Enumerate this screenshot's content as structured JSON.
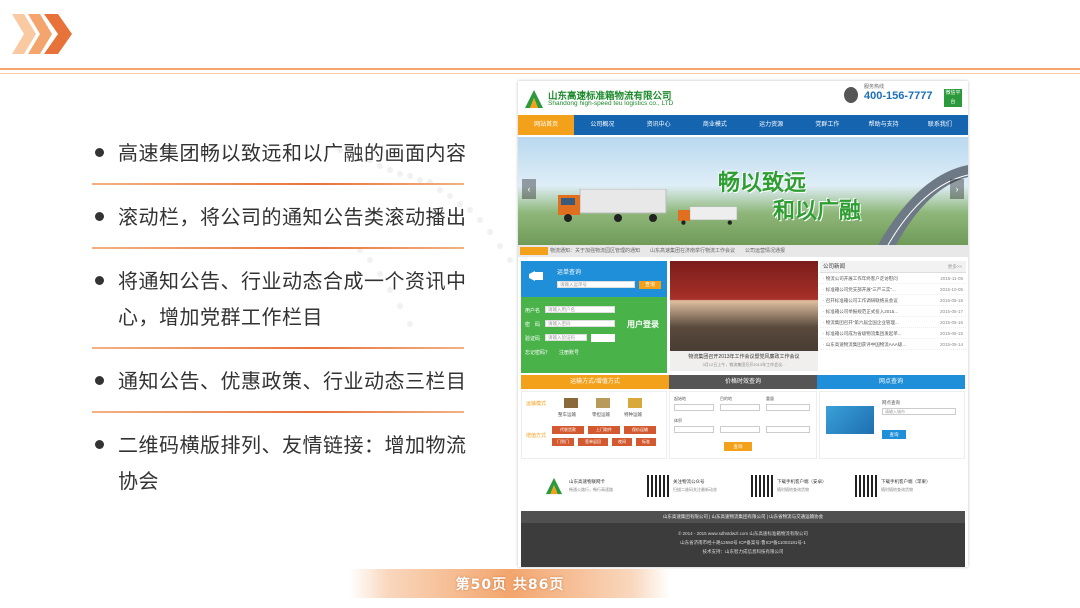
{
  "slide": {
    "bullets": [
      "高速集团畅以致远和以广融的画面内容",
      "滚动栏，将公司的通知公告类滚动播出",
      "将通知公告、行业动态合成一个资讯中心，增加党群工作栏目",
      "通知公告、优惠政策、行业动态三栏目",
      "二维码横版排列、友情链接：增加物流协会"
    ],
    "page_indicator": "第50页 共86页"
  },
  "site": {
    "company_cn": "山东高速标准箱物流有限公司",
    "company_en": "Shandong high-speed teu logistics co., LTD",
    "hotline_label": "服务热线",
    "phone": "400-156-7777",
    "wechat": "微信平台",
    "nav": [
      "网站首页",
      "公司概况",
      "资讯中心",
      "商业模式",
      "运力资源",
      "党群工作",
      "帮助与支持",
      "联系我们"
    ],
    "banner_line1": "畅以致远",
    "banner_line2": "和以广融",
    "ticker": "物流通知：关于加强物流园区管理的通知　　山东高速集团在济南举行物流工作会议　　公司运营情况通报",
    "login": {
      "search_title": "运单查询",
      "search_placeholder": "请输入运单号",
      "search_btn": "查询",
      "user_label": "用户名",
      "user_placeholder": "请输入用户名",
      "pass_label": "密　码",
      "pass_placeholder": "请输入密码",
      "code_label": "验证码",
      "code_placeholder": "请输入验证码",
      "title": "用户登录",
      "forgot": "忘记密码？",
      "register": "注册账号"
    },
    "news_caption": "物流集团召开2013年工作会议暨党风廉政工作会议",
    "news_sub": "3月12日上午，物流集团召开2013年工作会议...",
    "list_title": "公司新闻",
    "list_more": "更多>>",
    "news_list": [
      {
        "t": "物流公司开展工作年终客户走访慰问",
        "d": "2015-11-05"
      },
      {
        "t": "标准箱公司党支部开展\"三严三实\"...",
        "d": "2015-10-05"
      },
      {
        "t": "召开标准箱公司工作调研联络员会议",
        "d": "2015-05-18"
      },
      {
        "t": "标准箱公司举报规范正式投入2015...",
        "d": "2015-05-17"
      },
      {
        "t": "物流集团召开\"第六届全国企业管理...",
        "d": "2015-05-16"
      },
      {
        "t": "标准箱公司成为省级物流集团发起单...",
        "d": "2015-05-15"
      },
      {
        "t": "山东高速物流集团获评中国物流AAA级...",
        "d": "2015-05-14"
      }
    ],
    "bars": [
      {
        "label": "运输方式/增值方式",
        "color": "#f3a11a"
      },
      {
        "label": "价格时效查询",
        "color": "#555555"
      },
      {
        "label": "网点查询",
        "color": "#1e8fd8"
      }
    ],
    "transport_label": "运输模式",
    "value_label": "增值方式",
    "modes": [
      "整车运输",
      "零担运输",
      "特种运输"
    ],
    "value_items": [
      "代收货款",
      "上门取件",
      "保价运输",
      "门到门",
      "签单返回",
      "夜间",
      "标准"
    ],
    "price_fields": [
      "起始地",
      "目的地",
      "重量",
      "体积"
    ],
    "price_btn": "查询",
    "map_label": "网点查询",
    "map_placeholder": "请输入城市",
    "map_btn": "查询",
    "links": [
      {
        "title": "山东高速物联网卡",
        "sub": "畅通公路行，畅行高速路"
      },
      {
        "title": "关注物流公众号",
        "sub": "扫描二维码关注最新动态"
      },
      {
        "title": "下载手机客户端（安卓）",
        "sub": "随时随地查询货物"
      },
      {
        "title": "下载手机客户端（苹果）",
        "sub": "随时随地查询货物"
      }
    ],
    "footer_links": "山东高速集团有限公司 | 山东高速物流集团有限公司 | 山东省物流与交通运输协会",
    "footer_lines": [
      "© 2014 - 2015 www.sdhstdwzl.com 山东高速标准箱物流有限公司",
      "山东省济南市经十路12550号 ICP备案号:鲁ICP备11003181号-1",
      "技术支持：山东智力成信息科技有限公司"
    ]
  }
}
